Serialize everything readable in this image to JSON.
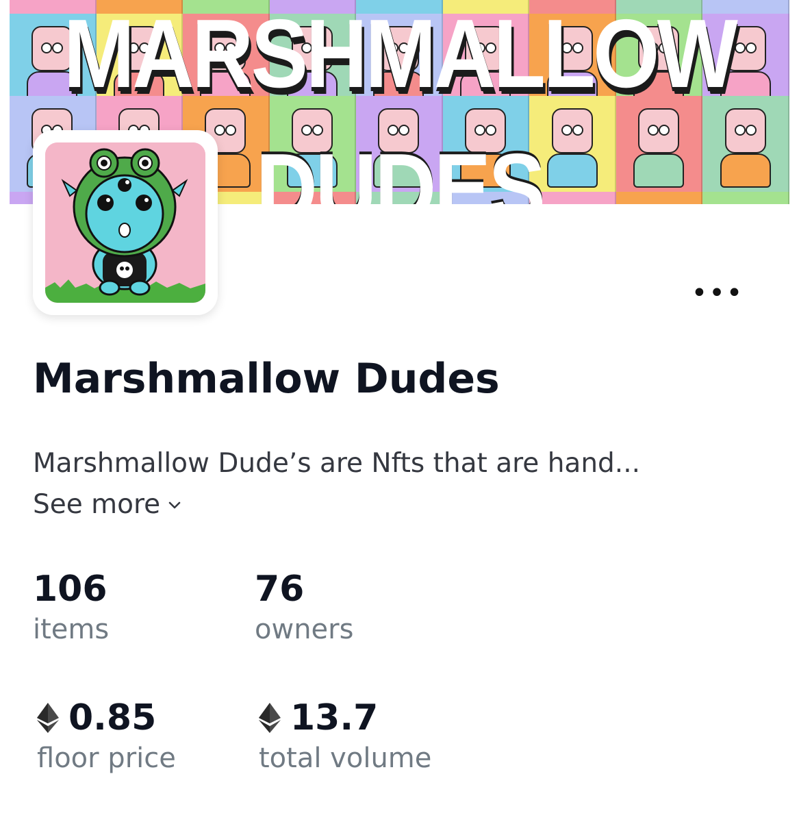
{
  "banner": {
    "line1": "MARSHMALLOW",
    "line2": "DUDES",
    "tile_colors": [
      "#f6a3c6",
      "#f7a34e",
      "#a4e28f",
      "#c9a6f2",
      "#7fd0e8",
      "#f5ec7a",
      "#f48c8c",
      "#9fd8b6",
      "#b8c5f5"
    ]
  },
  "collection": {
    "title": "Marshmallow Dudes",
    "description": "Marshmallow Dude’s are Nfts that are hand...",
    "see_more_label": "See more"
  },
  "more_icon": "more-horizontal-icon",
  "stats": {
    "items": {
      "value": "106",
      "label": "items"
    },
    "owners": {
      "value": "76",
      "label": "owners"
    },
    "floor_price": {
      "value": "0.85",
      "label": "floor price",
      "icon": "ethereum-icon"
    },
    "total_volume": {
      "value": "13.7",
      "label": "total volume",
      "icon": "ethereum-icon"
    }
  },
  "colors": {
    "title": "#0f1421",
    "body_text": "#353840",
    "muted_text": "#707a83",
    "avatar_bg": "#f4b6c8"
  }
}
